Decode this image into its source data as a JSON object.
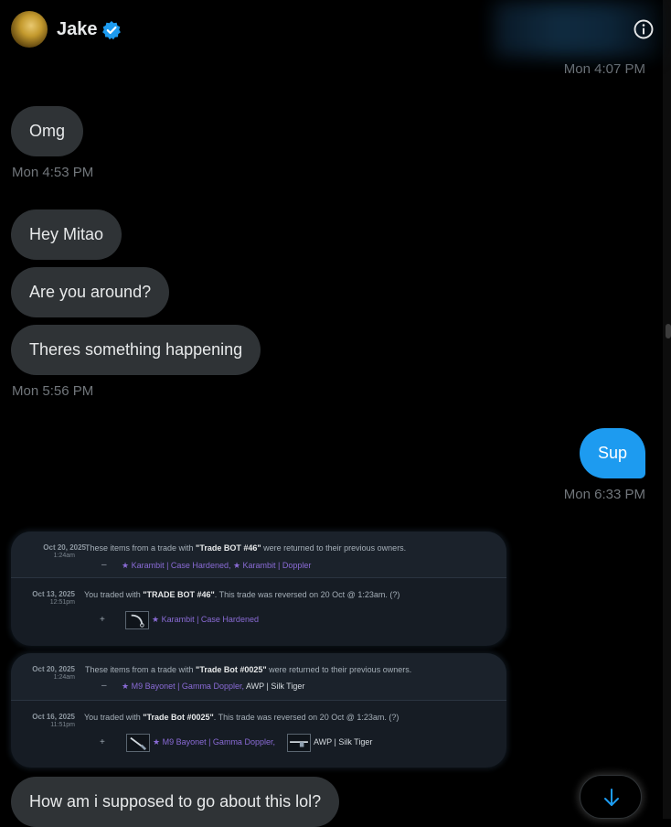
{
  "header": {
    "contact_name": "Jake",
    "verified_icon": "verified-badge-icon",
    "info_icon": "info-icon"
  },
  "messages": {
    "ts1": "Mon 4:07 PM",
    "m_omg": "Omg",
    "ts2": "Mon 4:53 PM",
    "m_hey": "Hey Mitao",
    "m_around": "Are you around?",
    "m_happening": "Theres something happening",
    "ts3": "Mon 5:56 PM",
    "m_sup": "Sup",
    "ts4": "Mon 6:33 PM",
    "m_how": "How am i supposed to go about this lol?"
  },
  "trade_cards": [
    {
      "returned": {
        "date": "Oct 20, 2025",
        "time": "1:24am",
        "text_pre": "These items from a trade with ",
        "bot": "\"Trade BOT #46\"",
        "text_post": " were returned to their previous owners.",
        "mark": "–",
        "items": "★ Karambit | Case Hardened, ★ Karambit | Doppler"
      },
      "traded": {
        "date": "Oct 13, 2025",
        "time": "12:51pm",
        "text_pre": "You traded with ",
        "bot": "\"TRADE BOT #46\"",
        "text_post": ". This trade was reversed on 20 Oct @ 1:23am. (?)",
        "mark": "+",
        "item1": "★ Karambit | Case Hardened"
      }
    },
    {
      "returned": {
        "date": "Oct 20, 2025",
        "time": "1:24am",
        "text_pre": "These items from a trade with ",
        "bot": "\"Trade Bot #0025\"",
        "text_post": " were returned to their previous owners.",
        "mark": "–",
        "items_purple": "★ M9 Bayonet | Gamma Doppler,",
        "items_plain": " AWP | Silk Tiger"
      },
      "traded": {
        "date": "Oct 16, 2025",
        "time": "11:51pm",
        "text_pre": "You traded with ",
        "bot": "\"Trade Bot #0025\"",
        "text_post": ". This trade was reversed on 20 Oct @ 1:23am. (?)",
        "mark": "+",
        "item1": "★ M9 Bayonet | Gamma Doppler,",
        "item2": "AWP | Silk Tiger"
      }
    }
  ],
  "controls": {
    "scroll_down_icon": "arrow-down-icon"
  },
  "colors": {
    "sent_bubble": "#1d9bf0",
    "received_bubble": "#2f3336",
    "verified": "#1d9bf0",
    "item_purple": "#8a6bd6"
  }
}
